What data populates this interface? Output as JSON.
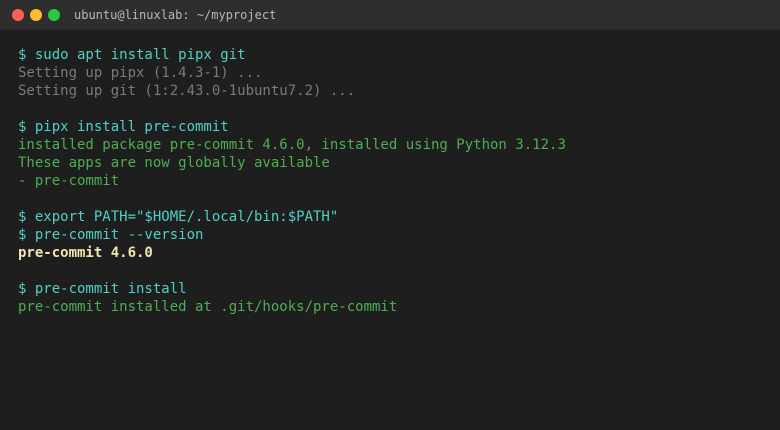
{
  "window": {
    "title": "ubuntu@linuxlab: ~/myproject",
    "traffic_lights": {
      "close_color": "#ff5f57",
      "minimize_color": "#febc2e",
      "maximize_color": "#28c840"
    }
  },
  "colors": {
    "background": "#1e1e1e",
    "titlebar": "#2e2e2e",
    "command": "#4fd1c5",
    "dim_output": "#7a7a7a",
    "success_output": "#4caf50",
    "highlight_output": "#f0e6b0"
  },
  "terminal": {
    "block1": {
      "cmd": "$ sudo apt install pipx git",
      "out1": "Setting up pipx (1.4.3-1) ...",
      "out2": "Setting up git (1:2.43.0-1ubuntu7.2) ..."
    },
    "block2": {
      "cmd": "$ pipx install pre-commit",
      "out1": "installed package pre-commit 4.6.0, installed using Python 3.12.3",
      "out2": "These apps are now globally available",
      "out3": "- pre-commit"
    },
    "block3": {
      "cmd1": "$ export PATH=\"$HOME/.local/bin:$PATH\"",
      "cmd2": "$ pre-commit --version",
      "out1": "pre-commit 4.6.0"
    },
    "block4": {
      "cmd": "$ pre-commit install",
      "out1": "pre-commit installed at .git/hooks/pre-commit"
    }
  }
}
